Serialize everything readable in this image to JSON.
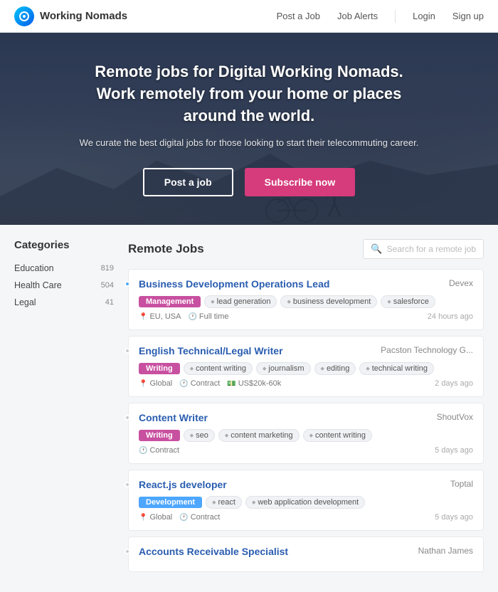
{
  "brand": {
    "name": "Working Nomads"
  },
  "navbar": {
    "links": [
      {
        "label": "Post a Job",
        "id": "post-job"
      },
      {
        "label": "Job Alerts",
        "id": "job-alerts"
      },
      {
        "label": "Login",
        "id": "login"
      },
      {
        "label": "Sign up",
        "id": "signup"
      }
    ]
  },
  "hero": {
    "title": "Remote jobs for Digital Working Nomads. Work remotely from your home or places around the world.",
    "subtitle": "We curate the best digital jobs for those looking to start their telecommuting career.",
    "btn_post": "Post a job",
    "btn_subscribe": "Subscribe now"
  },
  "sidebar": {
    "title": "Categories",
    "items": [
      {
        "label": "Education",
        "count": "819"
      },
      {
        "label": "Health Care",
        "count": "504"
      },
      {
        "label": "Legal",
        "count": "41"
      }
    ]
  },
  "joblist": {
    "title": "Remote Jobs",
    "search_placeholder": "Search for a remote job",
    "jobs": [
      {
        "id": 1,
        "title": "Business Development Operations Lead",
        "company": "Devex",
        "category": "Management",
        "category_type": "management",
        "tags": [
          "lead generation",
          "business development",
          "salesforce"
        ],
        "location": "EU, USA",
        "type": "Full time",
        "salary": null,
        "time_ago": "24 hours ago",
        "is_new": true
      },
      {
        "id": 2,
        "title": "English Technical/Legal Writer",
        "company": "Pacston Technology G...",
        "category": "Writing",
        "category_type": "writing",
        "tags": [
          "content writing",
          "journalism",
          "editing",
          "technical writing"
        ],
        "location": "Global",
        "type": "Contract",
        "salary": "US$20k-60k",
        "time_ago": "2 days ago",
        "is_new": false
      },
      {
        "id": 3,
        "title": "Content Writer",
        "company": "ShoutVox",
        "category": "Writing",
        "category_type": "writing",
        "tags": [
          "seo",
          "content marketing",
          "content writing"
        ],
        "location": null,
        "type": "Contract",
        "salary": null,
        "time_ago": "5 days ago",
        "is_new": false
      },
      {
        "id": 4,
        "title": "React.js developer",
        "company": "Toptal",
        "category": "Development",
        "category_type": "development",
        "tags": [
          "react",
          "web application development"
        ],
        "location": "Global",
        "type": "Contract",
        "salary": null,
        "time_ago": "5 days ago",
        "is_new": false
      },
      {
        "id": 5,
        "title": "Accounts Receivable Specialist",
        "company": "Nathan James",
        "category": null,
        "category_type": null,
        "tags": [],
        "location": null,
        "type": null,
        "salary": null,
        "time_ago": "",
        "is_new": false
      }
    ]
  }
}
